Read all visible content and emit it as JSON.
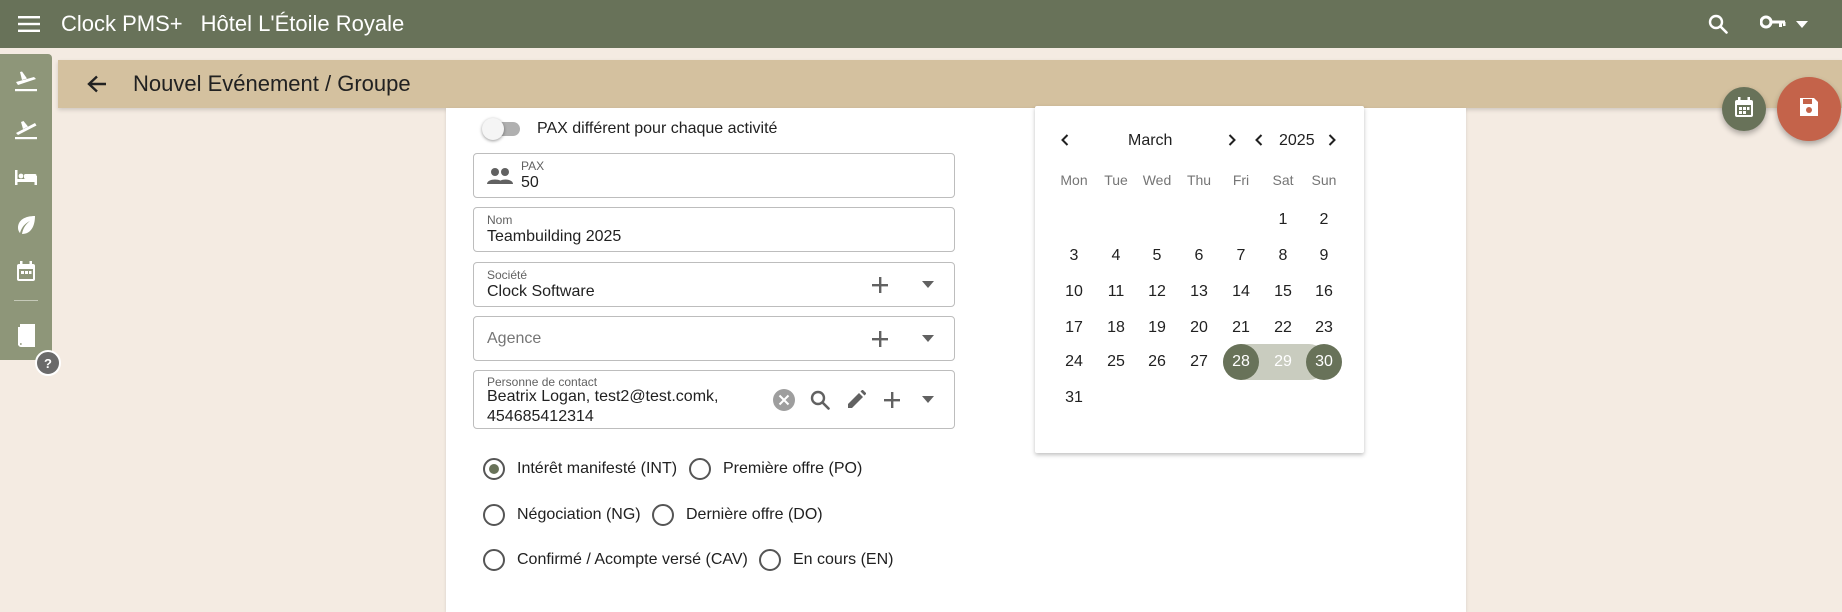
{
  "appbar": {
    "title": "Clock PMS+",
    "hotel": "Hôtel L'Étoile Royale"
  },
  "header": {
    "title": "Nouvel Evénement / Groupe"
  },
  "help": {
    "label": "?"
  },
  "form": {
    "toggle_label": "PAX différent pour chaque activité",
    "pax": {
      "label": "PAX",
      "value": "50"
    },
    "nom": {
      "label": "Nom",
      "value": "Teambuilding 2025"
    },
    "societe": {
      "label": "Société",
      "value": "Clock Software"
    },
    "agence": {
      "placeholder": "Agence"
    },
    "contact": {
      "label": "Personne de contact",
      "value_line1": "Beatrix Logan, test2@test.comk,",
      "value_line2": "454685412314"
    },
    "status_options": [
      {
        "label": "Intérêt manifesté (INT)",
        "selected": true
      },
      {
        "label": "Première offre (PO)",
        "selected": false
      },
      {
        "label": "Négociation (NG)",
        "selected": false
      },
      {
        "label": "Dernière offre (DO)",
        "selected": false
      },
      {
        "label": "Confirmé / Acompte versé (CAV)",
        "selected": false
      },
      {
        "label": "En cours (EN)",
        "selected": false
      }
    ]
  },
  "calendar": {
    "month": "March",
    "year": "2025",
    "weekdays": [
      "Mon",
      "Tue",
      "Wed",
      "Thu",
      "Fri",
      "Sat",
      "Sun"
    ],
    "days": [
      "1",
      "2",
      "3",
      "4",
      "5",
      "6",
      "7",
      "8",
      "9",
      "10",
      "11",
      "12",
      "13",
      "14",
      "15",
      "16",
      "17",
      "18",
      "19",
      "20",
      "21",
      "22",
      "23",
      "24",
      "25",
      "26",
      "27",
      "28",
      "29",
      "30",
      "31"
    ],
    "range_start": "28",
    "range_middle": "29",
    "range_end": "30"
  },
  "colors": {
    "primary": "#687259",
    "header": "#d4c19f",
    "accent": "#c4634a",
    "background": "#f4ebe2"
  }
}
